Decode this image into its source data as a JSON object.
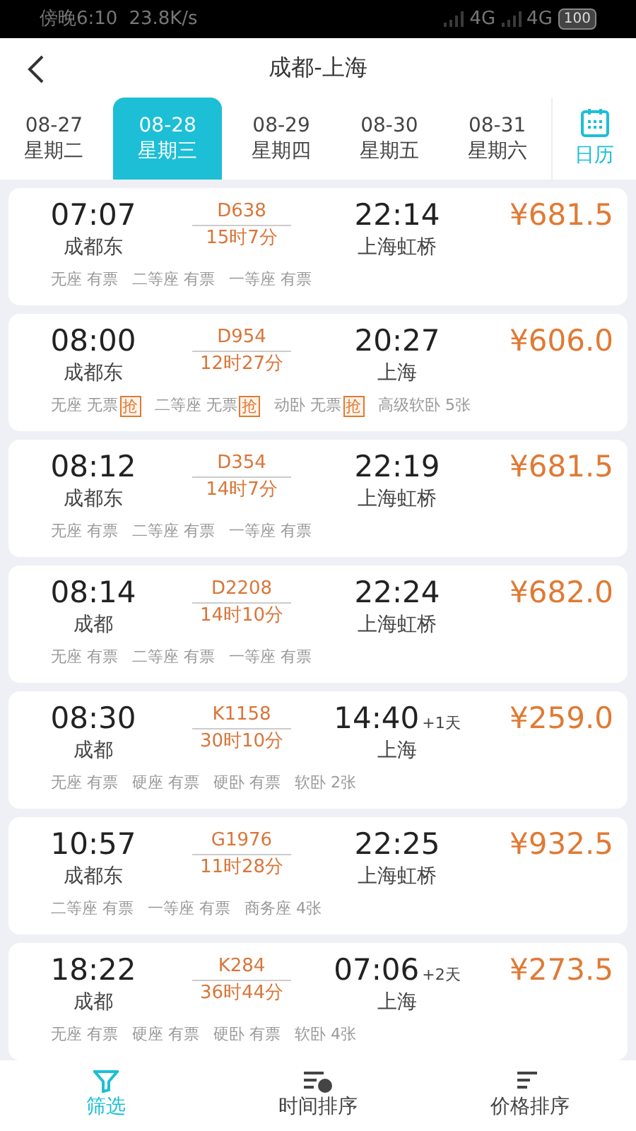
{
  "status_bar": {
    "time": "傍晚6:10",
    "speed": "23.8K/s",
    "network_1": "4G",
    "network_2": "4G",
    "battery": "100"
  },
  "header": {
    "title": "成都-上海"
  },
  "dates": [
    {
      "date": "08-27",
      "weekday": "星期二",
      "selected": false
    },
    {
      "date": "08-28",
      "weekday": "星期三",
      "selected": true
    },
    {
      "date": "08-29",
      "weekday": "星期四",
      "selected": false
    },
    {
      "date": "08-30",
      "weekday": "星期五",
      "selected": false
    },
    {
      "date": "08-31",
      "weekday": "星期六",
      "selected": false
    }
  ],
  "calendar_button": {
    "label": "日历"
  },
  "trains": [
    {
      "depart": "07:07",
      "from": "成都东",
      "train": "D638",
      "duration": "15时7分",
      "arrive": "22:14",
      "to": "上海虹桥",
      "price": "¥681.5",
      "seats": [
        {
          "name": "无座",
          "status": "有票",
          "grab": false
        },
        {
          "name": "二等座",
          "status": "有票",
          "grab": false
        },
        {
          "name": "一等座",
          "status": "有票",
          "grab": false
        }
      ]
    },
    {
      "depart": "08:00",
      "from": "成都东",
      "train": "D954",
      "duration": "12时27分",
      "arrive": "20:27",
      "to": "上海",
      "price": "¥606.0",
      "seats": [
        {
          "name": "无座",
          "status": "无票",
          "grab": true,
          "grab_label": "抢"
        },
        {
          "name": "二等座",
          "status": "无票",
          "grab": true,
          "grab_label": "抢"
        },
        {
          "name": "动卧",
          "status": "无票",
          "grab": true,
          "grab_label": "抢"
        },
        {
          "name": "高级软卧",
          "status": "5张",
          "grab": false
        }
      ]
    },
    {
      "depart": "08:12",
      "from": "成都东",
      "train": "D354",
      "duration": "14时7分",
      "arrive": "22:19",
      "to": "上海虹桥",
      "price": "¥681.5",
      "seats": [
        {
          "name": "无座",
          "status": "有票",
          "grab": false
        },
        {
          "name": "二等座",
          "status": "有票",
          "grab": false
        },
        {
          "name": "一等座",
          "status": "有票",
          "grab": false
        }
      ]
    },
    {
      "depart": "08:14",
      "from": "成都",
      "train": "D2208",
      "duration": "14时10分",
      "arrive": "22:24",
      "to": "上海虹桥",
      "price": "¥682.0",
      "seats": [
        {
          "name": "无座",
          "status": "有票",
          "grab": false
        },
        {
          "name": "二等座",
          "status": "有票",
          "grab": false
        },
        {
          "name": "一等座",
          "status": "有票",
          "grab": false
        }
      ]
    },
    {
      "depart": "08:30",
      "from": "成都",
      "train": "K1158",
      "duration": "30时10分",
      "arrive": "14:40",
      "day_offset": "+1天",
      "to": "上海",
      "price": "¥259.0",
      "seats": [
        {
          "name": "无座",
          "status": "有票",
          "grab": false
        },
        {
          "name": "硬座",
          "status": "有票",
          "grab": false
        },
        {
          "name": "硬卧",
          "status": "有票",
          "grab": false
        },
        {
          "name": "软卧",
          "status": "2张",
          "grab": false
        }
      ]
    },
    {
      "depart": "10:57",
      "from": "成都东",
      "train": "G1976",
      "duration": "11时28分",
      "arrive": "22:25",
      "to": "上海虹桥",
      "price": "¥932.5",
      "seats": [
        {
          "name": "二等座",
          "status": "有票",
          "grab": false
        },
        {
          "name": "一等座",
          "status": "有票",
          "grab": false
        },
        {
          "name": "商务座",
          "status": "4张",
          "grab": false
        }
      ]
    },
    {
      "depart": "18:22",
      "from": "成都",
      "train": "K284",
      "duration": "36时44分",
      "arrive": "07:06",
      "day_offset": "+2天",
      "to": "上海",
      "price": "¥273.5",
      "seats": [
        {
          "name": "无座",
          "status": "有票",
          "grab": false
        },
        {
          "name": "硬座",
          "status": "有票",
          "grab": false
        },
        {
          "name": "硬卧",
          "status": "有票",
          "grab": false
        },
        {
          "name": "软卧",
          "status": "4张",
          "grab": false
        }
      ]
    }
  ],
  "bottom_tabs": [
    {
      "label": "筛选",
      "kind": "filter",
      "selected": true
    },
    {
      "label": "时间排序",
      "kind": "time",
      "selected": false
    },
    {
      "label": "价格排序",
      "kind": "price",
      "selected": false
    }
  ]
}
